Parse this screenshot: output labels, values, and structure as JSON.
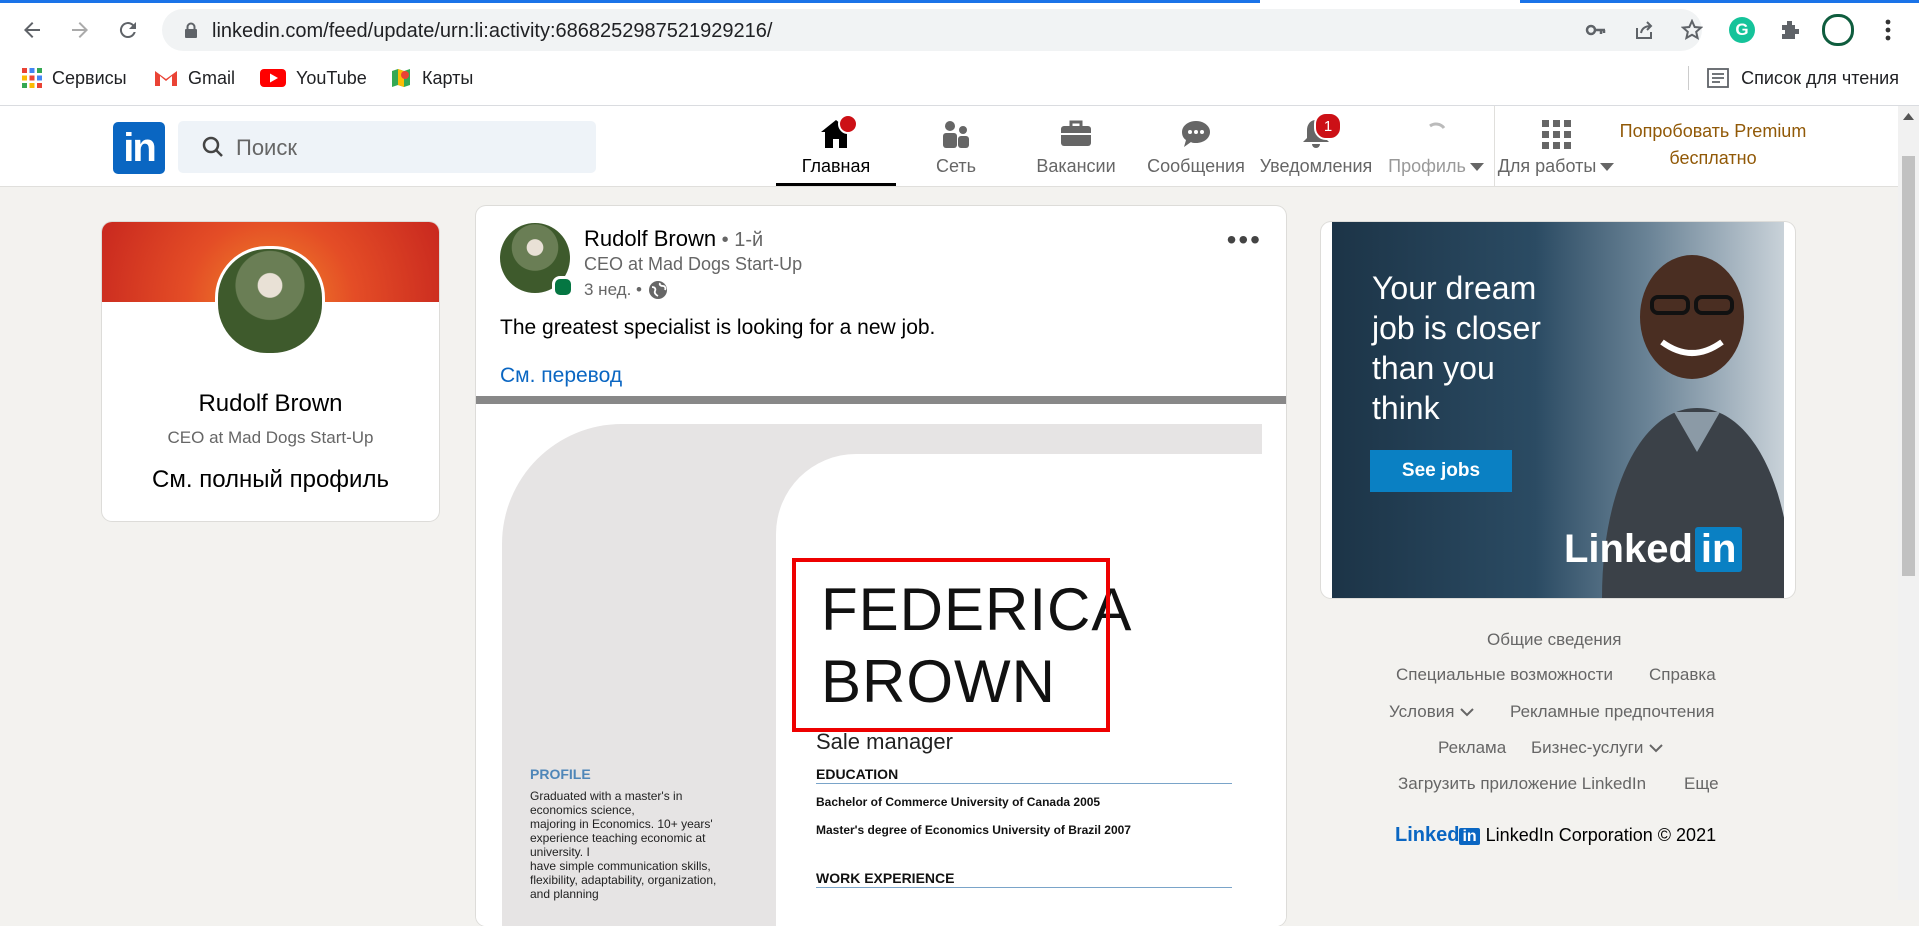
{
  "browser": {
    "url": "linkedin.com/feed/update/urn:li:activity:6868252987521929216/",
    "bookmarks": [
      {
        "label": "Сервисы",
        "icon": "apps-grid-icon"
      },
      {
        "label": "Gmail",
        "icon": "gmail-icon"
      },
      {
        "label": "YouTube",
        "icon": "youtube-icon"
      },
      {
        "label": "Карты",
        "icon": "maps-icon"
      }
    ],
    "reading_list": "Список для чтения"
  },
  "header": {
    "search_placeholder": "Поиск",
    "nav": [
      {
        "label": "Главная",
        "icon": "home-icon",
        "badge": ""
      },
      {
        "label": "Сеть",
        "icon": "network-icon",
        "badge": ""
      },
      {
        "label": "Вакансии",
        "icon": "briefcase-icon",
        "badge": ""
      },
      {
        "label": "Сообщения",
        "icon": "messages-icon",
        "badge": ""
      },
      {
        "label": "Уведомления",
        "icon": "bell-icon",
        "badge": "1"
      },
      {
        "label": "Профиль",
        "icon": "profile-icon",
        "badge": ""
      },
      {
        "label": "Для работы",
        "icon": "grid-icon",
        "badge": ""
      }
    ],
    "premium": [
      "Попробовать Premium",
      "бесплатно"
    ]
  },
  "profile_card": {
    "name": "Rudolf Brown",
    "headline": "CEO at Mad Dogs Start-Up",
    "link": "См. полный профиль"
  },
  "post": {
    "author": "Rudolf Brown",
    "degree": " • 1-й",
    "headline": "CEO at Mad Dogs Start-Up",
    "time": "3 нед. •",
    "text": "The greatest specialist is looking for a new job.",
    "translate": "См. перевод",
    "resume": {
      "name_line1": "FEDERICA",
      "name_line2": "BROWN",
      "role": "Sale manager",
      "education_head": "EDUCATION",
      "education": [
        "Bachelor of Commerce University of Canada 2005",
        "Master's degree of Economics University of Brazil 2007"
      ],
      "work_head": "WORK EXPERIENCE",
      "profile_head": "PROFILE",
      "profile_body": [
        "Graduated with a master's in",
        "economics science,",
        "majoring in Economics. 10+ years'",
        "experience teaching economic at",
        "university. I",
        "have simple communication skills,",
        "flexibility, adaptability, organization,",
        "and planning"
      ]
    }
  },
  "ad": {
    "lines": [
      "Your dream",
      "job is closer",
      "than you",
      "think"
    ],
    "button": "See jobs",
    "logo_word": "Linked",
    "logo_in": "in"
  },
  "footer": {
    "links": [
      "Общие сведения",
      "Специальные возможности",
      "Справка",
      "Условия",
      "Рекламные предпочтения",
      "Реклама",
      "Бизнес-услуги",
      "Загрузить приложение LinkedIn",
      "Еще"
    ],
    "logo_word": "Linked",
    "logo_in": "in",
    "copyright": "LinkedIn Corporation © 2021"
  },
  "colors": {
    "accent": "#0a66c2",
    "badge": "#cc1016",
    "premium": "#915907",
    "highlight_box": "#ee0000"
  }
}
